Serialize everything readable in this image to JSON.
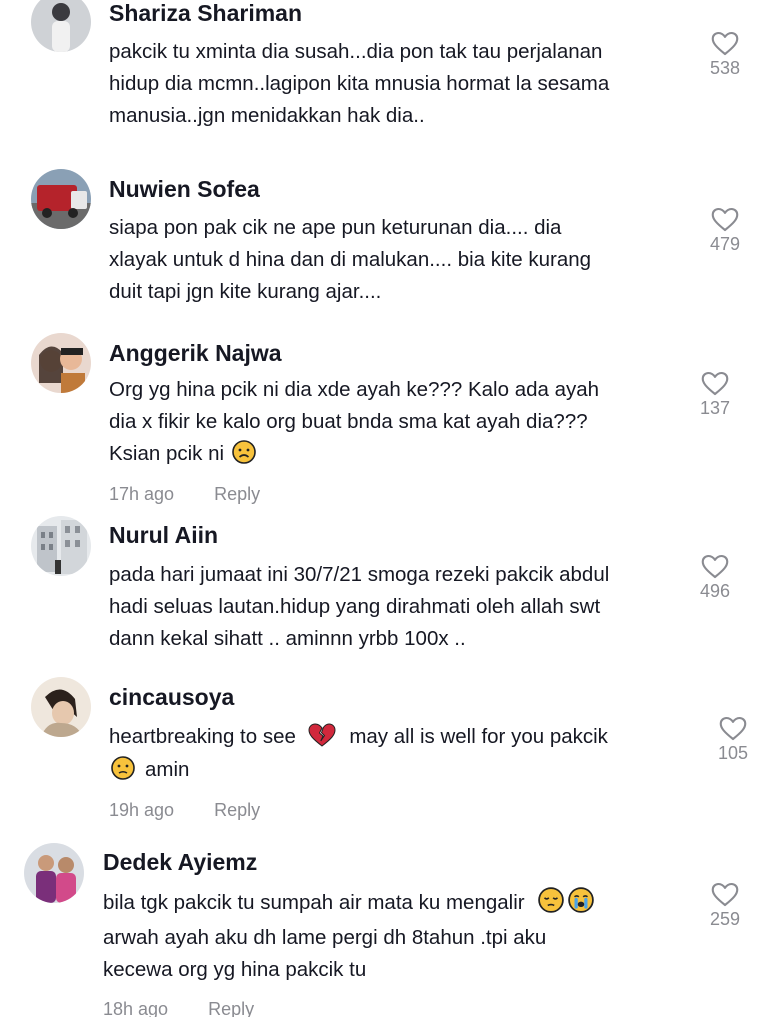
{
  "colors": {
    "text": "#161823",
    "muted": "#8a8b91",
    "emoji": "#f7c23c",
    "broken_heart": "#d1283c"
  },
  "comments": [
    {
      "name": "Shariza Shariman",
      "lines": [
        "pakcik tu xminta dia susah...dia pon tak tau perjalanan",
        "hidup dia mcmn..lagipon kita mnusia hormat la sesama",
        "manusia..jgn menidakkan hak dia.."
      ],
      "likes": "538",
      "time": "",
      "reply": ""
    },
    {
      "name": "Nuwien Sofea",
      "lines": [
        "siapa pon pak cik ne ape pun keturunan dia.... dia",
        "xlayak untuk d hina dan di malukan.... bia kite kurang",
        "duit tapi jgn kite kurang ajar...."
      ],
      "likes": "479",
      "time": "",
      "reply": ""
    },
    {
      "name": "Anggerik Najwa",
      "lines": [
        "Org yg hina pcik ni dia xde ayah ke??? Kalo ada ayah",
        "dia x fikir ke kalo org buat bnda sma kat ayah dia???",
        "Ksian pcik ni"
      ],
      "likes": "137",
      "time": "17h ago",
      "reply": "Reply"
    },
    {
      "name": "Nurul Aiin",
      "lines": [
        "pada hari jumaat ini 30/7/21 smoga rezeki pakcik abdul",
        "hadi seluas lautan.hidup yang dirahmati oleh allah swt",
        "dann kekal sihatt .. aminnn yrbb 100x .."
      ],
      "likes": "496",
      "time": "",
      "reply": ""
    },
    {
      "name": "cincausoya",
      "lines": [
        "heartbreaking to see",
        "may all is well for you pakcik",
        "amin"
      ],
      "likes": "105",
      "time": "19h ago",
      "reply": "Reply"
    },
    {
      "name": "Dedek Ayiemz",
      "lines": [
        "bila tgk pakcik tu sumpah air mata ku mengalir",
        "arwah ayah aku dh lame pergi dh 8tahun .tpi aku",
        "kecewa org yg hina pakcik tu"
      ],
      "likes": "259",
      "time": "18h ago",
      "reply": "Reply"
    }
  ]
}
